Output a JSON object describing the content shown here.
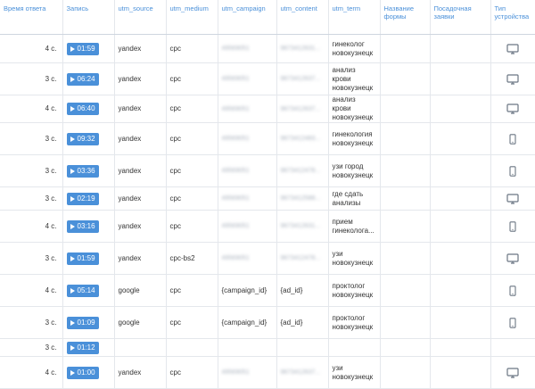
{
  "headers": [
    "Время ответа",
    "Запись",
    "utm_source",
    "utm_medium",
    "utm_campaign",
    "utm_content",
    "utm_term",
    "Название формы",
    "Посадочная заявки",
    "Тип устройства"
  ],
  "rows": [
    {
      "time": "4 с.",
      "rec": "01:59",
      "source": "yandex",
      "medium": "cpc",
      "campaign": "49569051",
      "content": "9673412631...",
      "term": "гинеколог новокузнецк",
      "form": "",
      "landing": "",
      "device": "desktop-icon"
    },
    {
      "time": "3 с.",
      "rec": "06:24",
      "source": "yandex",
      "medium": "cpc",
      "campaign": "49569051",
      "content": "9673412637...",
      "term": "анализ крови новокузнецк",
      "form": "",
      "landing": "",
      "device": "desktop-icon"
    },
    {
      "time": "4 с.",
      "rec": "06:40",
      "source": "yandex",
      "medium": "cpc",
      "campaign": "49569051",
      "content": "9673412637...",
      "term": "анализ крови новокузнецк",
      "form": "",
      "landing": "",
      "device": "desktop-icon"
    },
    {
      "time": "3 с.",
      "rec": "09:32",
      "source": "yandex",
      "medium": "cpc",
      "campaign": "49569051",
      "content": "9673412483...",
      "term": "гинекология новокузнецк",
      "form": "",
      "landing": "",
      "device": "mobile-icon"
    },
    {
      "time": "3 с.",
      "rec": "03:36",
      "source": "yandex",
      "medium": "cpc",
      "campaign": "49569051",
      "content": "9673412478...",
      "term": "узи город новокузнецк",
      "form": "",
      "landing": "",
      "device": "mobile-icon"
    },
    {
      "time": "3 с.",
      "rec": "02:19",
      "source": "yandex",
      "medium": "cpc",
      "campaign": "49569051",
      "content": "9673412588...",
      "term": "где сдать анализы",
      "form": "",
      "landing": "",
      "device": "desktop-icon"
    },
    {
      "time": "4 с.",
      "rec": "03:16",
      "source": "yandex",
      "medium": "cpc",
      "campaign": "49569051",
      "content": "9673412631...",
      "term": "прием гинеколога...",
      "form": "",
      "landing": "",
      "device": "mobile-icon"
    },
    {
      "time": "3 с.",
      "rec": "01:59",
      "source": "yandex",
      "medium": "cpc-bs2",
      "campaign": "49569051",
      "content": "9673412478...",
      "term": "узи новокузнецк",
      "form": "",
      "landing": "",
      "device": "desktop-icon"
    },
    {
      "time": "4 с.",
      "rec": "05:14",
      "source": "google",
      "medium": "cpc",
      "campaign": "{campaign_id}",
      "content": "{ad_id}",
      "term": "проктолог новокузнецк",
      "form": "",
      "landing": "",
      "device": "mobile-icon"
    },
    {
      "time": "3 с.",
      "rec": "01:09",
      "source": "google",
      "medium": "cpc",
      "campaign": "{campaign_id}",
      "content": "{ad_id}",
      "term": "проктолог новокузнецк",
      "form": "",
      "landing": "",
      "device": "mobile-icon"
    },
    {
      "time": "3 с.",
      "rec": "01:12",
      "source": "",
      "medium": "",
      "campaign": "",
      "content": "",
      "term": "",
      "form": "",
      "landing": "",
      "device": ""
    },
    {
      "time": "4 с.",
      "rec": "01:00",
      "source": "yandex",
      "medium": "cpc",
      "campaign": "49569051",
      "content": "9673412637...",
      "term": "узи новокузнецк",
      "form": "",
      "landing": "",
      "device": "desktop-icon"
    }
  ],
  "colors": {
    "accent": "#4a90d9",
    "border": "#e4e7ec"
  }
}
